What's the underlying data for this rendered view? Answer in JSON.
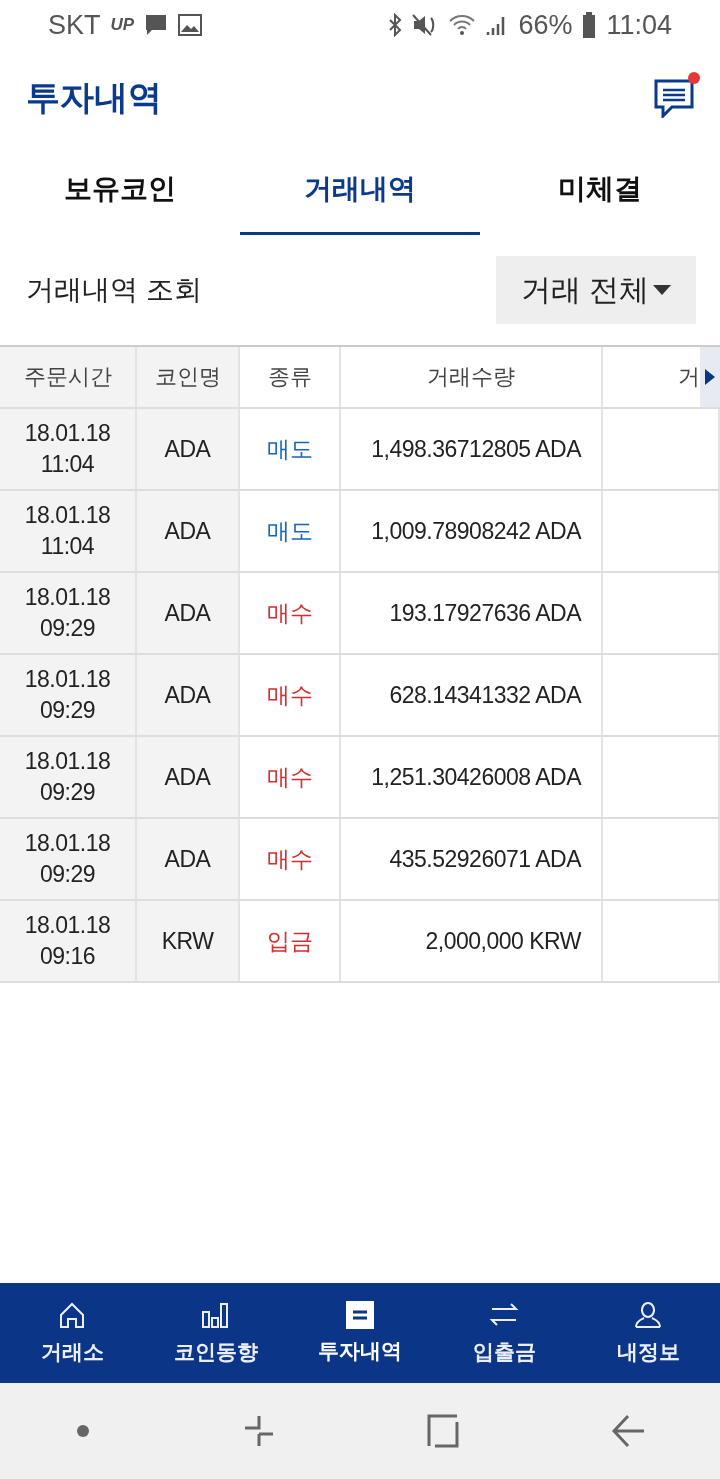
{
  "status_bar": {
    "carrier": "SKT",
    "carrier_badge": "UP",
    "battery": "66%",
    "time": "11:04"
  },
  "header": {
    "title": "투자내역",
    "has_notification": true
  },
  "tabs": [
    {
      "label": "보유코인",
      "selected": false
    },
    {
      "label": "거래내역",
      "selected": true
    },
    {
      "label": "미체결",
      "selected": false
    }
  ],
  "filter": {
    "label": "거래내역 조회",
    "dropdown": "거래 전체"
  },
  "table": {
    "columns": [
      "주문시간",
      "코인명",
      "종류",
      "거래수량",
      "거"
    ],
    "rows": [
      {
        "date": "18.01.18",
        "time": "11:04",
        "coin": "ADA",
        "type": "매도",
        "kind": "sell",
        "amount": "1,498.36712805 ADA"
      },
      {
        "date": "18.01.18",
        "time": "11:04",
        "coin": "ADA",
        "type": "매도",
        "kind": "sell",
        "amount": "1,009.78908242 ADA"
      },
      {
        "date": "18.01.18",
        "time": "09:29",
        "coin": "ADA",
        "type": "매수",
        "kind": "buy",
        "amount": "193.17927636 ADA"
      },
      {
        "date": "18.01.18",
        "time": "09:29",
        "coin": "ADA",
        "type": "매수",
        "kind": "buy",
        "amount": "628.14341332 ADA"
      },
      {
        "date": "18.01.18",
        "time": "09:29",
        "coin": "ADA",
        "type": "매수",
        "kind": "buy",
        "amount": "1,251.30426008 ADA"
      },
      {
        "date": "18.01.18",
        "time": "09:29",
        "coin": "ADA",
        "type": "매수",
        "kind": "buy",
        "amount": "435.52926071 ADA"
      },
      {
        "date": "18.01.18",
        "time": "09:16",
        "coin": "KRW",
        "type": "입금",
        "kind": "deposit",
        "amount": "2,000,000 KRW"
      }
    ]
  },
  "bottom_nav": [
    {
      "label": "거래소",
      "kind": "home",
      "selected": false
    },
    {
      "label": "코인동향",
      "kind": "chart",
      "selected": false
    },
    {
      "label": "투자내역",
      "kind": "list",
      "selected": true
    },
    {
      "label": "입출금",
      "kind": "transfer",
      "selected": false
    },
    {
      "label": "내정보",
      "kind": "user",
      "selected": false
    }
  ]
}
